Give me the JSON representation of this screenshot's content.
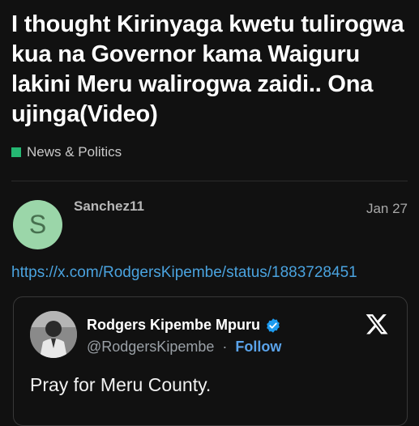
{
  "topic": {
    "title": "I thought Kirinyaga kwetu tulirogwa kua na Governor kama Waiguru lakini Meru walirogwa zaidi.. Ona ujinga(Video)",
    "category": {
      "label": "News & Politics",
      "color": "#25b772"
    }
  },
  "post": {
    "avatar_letter": "S",
    "avatar_color": "#9bd6a9",
    "username": "Sanchez11",
    "date": "Jan 27",
    "link": "https://x.com/RodgersKipembe/status/1883728451"
  },
  "embed": {
    "author_name": "Rodgers Kipembe Mpuru",
    "handle": "@RodgersKipembe",
    "separator": "·",
    "follow_label": "Follow",
    "text": "Pray for Meru County.",
    "verified_icon": "verified-badge-icon",
    "platform_icon": "x-logo-icon"
  }
}
